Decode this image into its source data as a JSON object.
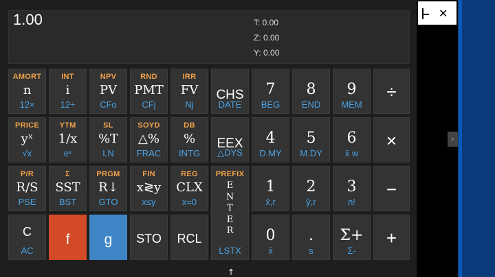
{
  "display": {
    "value": "1.00",
    "t": "T: 0.00",
    "z": "Z: 0.00",
    "y": "Y: 0.00"
  },
  "keys": [
    {
      "id": "n",
      "top": "AMORT",
      "main": "n",
      "bot": "12×"
    },
    {
      "id": "i",
      "top": "INT",
      "main": "i",
      "bot": "12÷"
    },
    {
      "id": "pv",
      "top": "NPV",
      "main": "PV",
      "bot": "CFo"
    },
    {
      "id": "pmt",
      "top": "RND",
      "main": "PMT",
      "bot": "CFj"
    },
    {
      "id": "fv",
      "top": "IRR",
      "main": "FV",
      "bot": "Nj"
    },
    {
      "id": "chs",
      "top": "",
      "main": "CHS",
      "bot": "DATE"
    },
    {
      "id": "7",
      "top": "",
      "main": "7",
      "bot": "BEG"
    },
    {
      "id": "8",
      "top": "",
      "main": "8",
      "bot": "END"
    },
    {
      "id": "9",
      "top": "",
      "main": "9",
      "bot": "MEM"
    },
    {
      "id": "divide",
      "top": "",
      "main": "÷",
      "bot": ""
    },
    {
      "id": "yx",
      "top": "PRICE",
      "main": "yˣ",
      "bot": "√x"
    },
    {
      "id": "1x",
      "top": "YTM",
      "main": "1/x",
      "bot": "eˣ"
    },
    {
      "id": "pctT",
      "top": "SL",
      "main": "%T",
      "bot": "LN"
    },
    {
      "id": "dpct",
      "top": "SOYD",
      "main": "△%",
      "bot": "FRAC"
    },
    {
      "id": "pct",
      "top": "DB",
      "main": "%",
      "bot": "INTG"
    },
    {
      "id": "eex",
      "top": "",
      "main": "EEX",
      "bot": "△DYS"
    },
    {
      "id": "4",
      "top": "",
      "main": "4",
      "bot": "D.MY"
    },
    {
      "id": "5",
      "top": "",
      "main": "5",
      "bot": "M.DY"
    },
    {
      "id": "6",
      "top": "",
      "main": "6",
      "bot": "x̄ w"
    },
    {
      "id": "multiply",
      "top": "",
      "main": "×",
      "bot": ""
    },
    {
      "id": "rs",
      "top": "P/R",
      "main": "R/S",
      "bot": "PSE"
    },
    {
      "id": "sst",
      "top": "Σ",
      "main": "SST",
      "bot": "BST"
    },
    {
      "id": "rdown",
      "top": "PRGM",
      "main": "R↓",
      "bot": "GTO"
    },
    {
      "id": "xy",
      "top": "FIN",
      "main": "x≷y",
      "bot": "x≤y"
    },
    {
      "id": "clx",
      "top": "REG",
      "main": "CLX",
      "bot": "x=0"
    },
    {
      "id": "enter",
      "top": "PREFIX",
      "main": "ENTER",
      "bot": "LSTX"
    },
    {
      "id": "1",
      "top": "",
      "main": "1",
      "bot": "x̂,r"
    },
    {
      "id": "2",
      "top": "",
      "main": "2",
      "bot": "ŷ,r"
    },
    {
      "id": "3",
      "top": "",
      "main": "3",
      "bot": "n!"
    },
    {
      "id": "minus",
      "top": "",
      "main": "−",
      "bot": ""
    },
    {
      "id": "on",
      "top": "",
      "main": "C",
      "bot": "AC"
    },
    {
      "id": "f",
      "top": "",
      "main": "f",
      "bot": ""
    },
    {
      "id": "g",
      "top": "",
      "main": "g",
      "bot": ""
    },
    {
      "id": "sto",
      "top": "",
      "main": "STO",
      "bot": ""
    },
    {
      "id": "rcl",
      "top": "",
      "main": "RCL",
      "bot": ""
    },
    {
      "id": "0",
      "top": "",
      "main": "0",
      "bot": "x̄"
    },
    {
      "id": "dot",
      "top": "",
      "main": ".",
      "bot": "s"
    },
    {
      "id": "sigma",
      "top": "",
      "main": "Σ+",
      "bot": "Σ-"
    },
    {
      "id": "plus",
      "top": "",
      "main": "+",
      "bot": ""
    }
  ],
  "enter_letters": [
    "E",
    "N",
    "T",
    "E",
    "R"
  ],
  "window": {
    "close_glyph": "✕",
    "side_glyph": "›",
    "cursor_glyph": "↑"
  },
  "colors": {
    "f_key": "#d24a26",
    "g_key": "#3f86c6",
    "f_label": "#f0a24a",
    "g_label": "#4aa3e6"
  }
}
